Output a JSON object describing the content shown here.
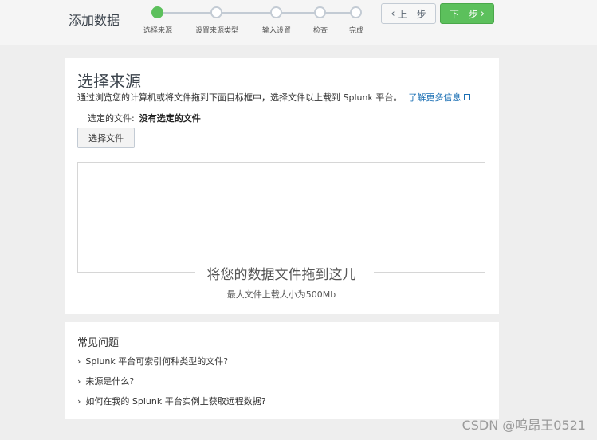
{
  "header": {
    "title": "添加数据"
  },
  "steps": [
    {
      "label": "选择来源",
      "active": true
    },
    {
      "label": "设置来源类型",
      "active": false
    },
    {
      "label": "输入设置",
      "active": false
    },
    {
      "label": "检查",
      "active": false
    },
    {
      "label": "完成",
      "active": false
    }
  ],
  "nav": {
    "back_label": "上一步",
    "next_label": "下一步"
  },
  "source": {
    "title": "选择来源",
    "description": "通过浏览您的计算机或将文件拖到下面目标框中，选择文件以上载到 Splunk 平台。",
    "learn_more": "了解更多信息",
    "selected_label": "选定的文件:",
    "selected_value": "没有选定的文件",
    "choose_button": "选择文件",
    "drop_text": "将您的数据文件拖到这儿",
    "max_size": "最大文件上载大小为500Mb"
  },
  "faq": {
    "title": "常见问题",
    "items": [
      "Splunk 平台可索引何种类型的文件?",
      "来源是什么?",
      "如何在我的 Splunk 平台实例上获取远程数据?"
    ]
  },
  "watermark": "CSDN @呜昂王0521",
  "colors": {
    "accent_green": "#5cc05c",
    "link_blue": "#1a6fb4",
    "step_gray": "#c3cbd4"
  }
}
